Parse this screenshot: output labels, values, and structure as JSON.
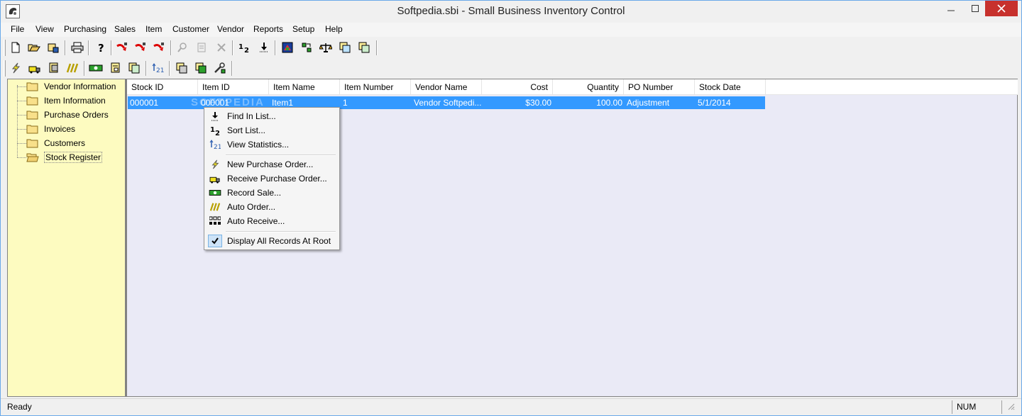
{
  "window": {
    "title": "Softpedia.sbi - Small Business Inventory Control"
  },
  "menu": [
    "File",
    "View",
    "Purchasing",
    "Sales",
    "Item",
    "Customer",
    "Vendor",
    "Reports",
    "Setup",
    "Help"
  ],
  "tree": {
    "items": [
      "Vendor Information",
      "Item Information",
      "Purchase Orders",
      "Invoices",
      "Customers",
      "Stock Register"
    ],
    "selected": "Stock Register"
  },
  "grid": {
    "columns": [
      "Stock ID",
      "Item ID",
      "Item Name",
      "Item Number",
      "Vendor Name",
      "Cost",
      "Quantity",
      "PO Number",
      "Stock Date"
    ],
    "rows": [
      [
        "000001",
        "000001",
        "Item1",
        "1",
        "Vendor Softpedi...",
        "$30.00",
        "100.00",
        "Adjustment",
        "5/1/2014"
      ]
    ],
    "watermark": "SOFTPEDIA"
  },
  "context_menu": {
    "items": [
      "Find In List...",
      "Sort List...",
      "View Statistics...",
      "New Purchase Order...",
      "Receive Purchase Order...",
      "Record Sale...",
      "Auto Order...",
      "Auto Receive...",
      "Display All Records At Root"
    ]
  },
  "toolbar": {
    "sort_glyph": "1 2",
    "stats_glyph": "↑2↓"
  },
  "status": {
    "text": "Ready",
    "num": "NUM"
  },
  "colors": {
    "selection": "#3399ff",
    "tree_bg": "#fdfbc0",
    "grid_bg": "#eaeaf6",
    "close_btn": "#c7312d"
  }
}
